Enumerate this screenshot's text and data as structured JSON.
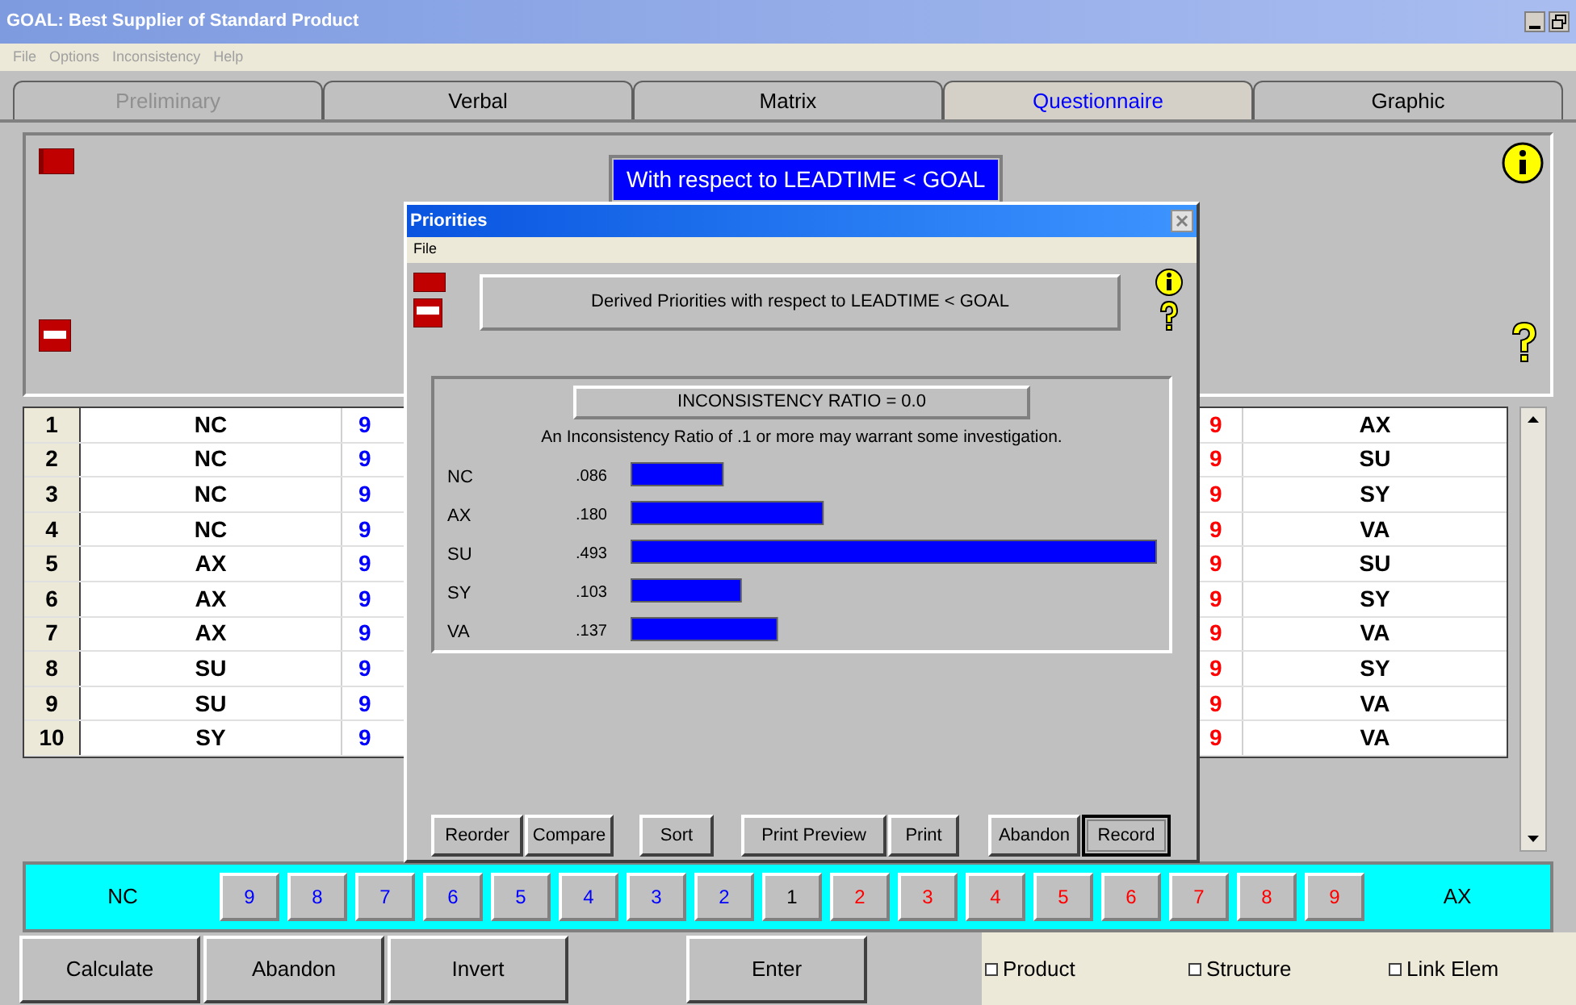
{
  "window": {
    "title": "GOAL: Best Supplier of Standard Product"
  },
  "menu": [
    "File",
    "Options",
    "Inconsistency",
    "Help"
  ],
  "tabs": [
    {
      "label": "Preliminary",
      "selected": false,
      "disabled": true
    },
    {
      "label": "Verbal",
      "selected": false,
      "disabled": false
    },
    {
      "label": "Matrix",
      "selected": false,
      "disabled": false
    },
    {
      "label": "Questionnaire",
      "selected": true,
      "disabled": false
    },
    {
      "label": "Graphic",
      "selected": false,
      "disabled": false
    }
  ],
  "panel": {
    "heading": "With respect to LEADTIME < GOAL"
  },
  "comparisons": [
    {
      "number": "1",
      "left": "NC",
      "left_value": "9",
      "right_value": "9",
      "right": "AX"
    },
    {
      "number": "2",
      "left": "NC",
      "left_value": "9",
      "right_value": "9",
      "right": "SU"
    },
    {
      "number": "3",
      "left": "NC",
      "left_value": "9",
      "right_value": "9",
      "right": "SY"
    },
    {
      "number": "4",
      "left": "NC",
      "left_value": "9",
      "right_value": "9",
      "right": "VA"
    },
    {
      "number": "5",
      "left": "AX",
      "left_value": "9",
      "right_value": "9",
      "right": "SU"
    },
    {
      "number": "6",
      "left": "AX",
      "left_value": "9",
      "right_value": "9",
      "right": "SY"
    },
    {
      "number": "7",
      "left": "AX",
      "left_value": "9",
      "right_value": "9",
      "right": "VA"
    },
    {
      "number": "8",
      "left": "SU",
      "left_value": "9",
      "right_value": "9",
      "right": "SY"
    },
    {
      "number": "9",
      "left": "SU",
      "left_value": "9",
      "right_value": "9",
      "right": "VA"
    },
    {
      "number": "10",
      "left": "SY",
      "left_value": "9",
      "right_value": "9",
      "right": "VA"
    }
  ],
  "scale": {
    "left": "NC",
    "right": "AX",
    "buttons": [
      {
        "label": "9",
        "color": "#0000ff"
      },
      {
        "label": "8",
        "color": "#0000ff"
      },
      {
        "label": "7",
        "color": "#0000ff"
      },
      {
        "label": "6",
        "color": "#0000ff"
      },
      {
        "label": "5",
        "color": "#0000ff"
      },
      {
        "label": "4",
        "color": "#0000ff"
      },
      {
        "label": "3",
        "color": "#0000ff"
      },
      {
        "label": "2",
        "color": "#0000ff"
      },
      {
        "label": "1",
        "color": "#000000"
      },
      {
        "label": "2",
        "color": "#ff0000"
      },
      {
        "label": "3",
        "color": "#ff0000"
      },
      {
        "label": "4",
        "color": "#ff0000"
      },
      {
        "label": "5",
        "color": "#ff0000"
      },
      {
        "label": "6",
        "color": "#ff0000"
      },
      {
        "label": "7",
        "color": "#ff0000"
      },
      {
        "label": "8",
        "color": "#ff0000"
      },
      {
        "label": "9",
        "color": "#ff0000"
      }
    ]
  },
  "actions": [
    "Calculate",
    "Abandon",
    "Invert",
    "Enter"
  ],
  "options": [
    {
      "label": "Product",
      "checked": false
    },
    {
      "label": "Structure",
      "checked": false
    },
    {
      "label": "Link Elem",
      "checked": false
    }
  ],
  "dialog": {
    "title": "Priorities",
    "menu": [
      "File"
    ],
    "heading": "Derived Priorities with respect to LEADTIME < GOAL",
    "ratio": "INCONSISTENCY RATIO = 0.0",
    "note": "An Inconsistency Ratio of .1 or more may warrant some investigation.",
    "chart_data": {
      "type": "bar",
      "orientation": "horizontal",
      "categories": [
        "NC",
        "AX",
        "SU",
        "SY",
        "VA"
      ],
      "values": [
        0.086,
        0.18,
        0.493,
        0.103,
        0.137
      ],
      "data_labels": true,
      "value_labels": [
        ".086",
        ".180",
        ".493",
        ".103",
        ".137"
      ]
    },
    "buttons": [
      {
        "label": "Reorder",
        "default": false
      },
      {
        "label": "Compare",
        "default": false
      },
      {
        "label": "Sort",
        "default": false
      },
      {
        "label": "Print Preview",
        "default": false
      },
      {
        "label": "Print",
        "default": false
      },
      {
        "label": "Abandon",
        "default": false
      },
      {
        "label": "Record",
        "default": true
      }
    ]
  }
}
